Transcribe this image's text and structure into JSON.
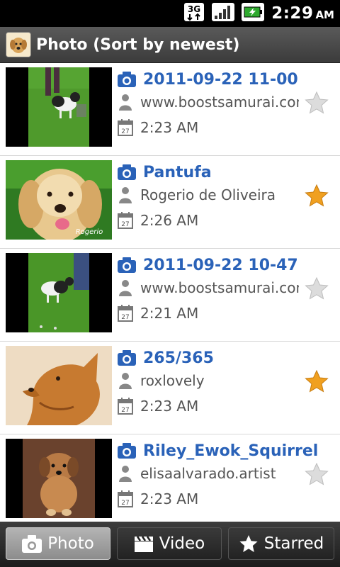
{
  "status_bar": {
    "network": "3G",
    "time": "2:29",
    "ampm": "AM"
  },
  "header": {
    "title": "Photo (Sort by newest)"
  },
  "photos": [
    {
      "title": "2011-09-22 11-00",
      "author": "www.boostsamurai.com",
      "time": "2:23 AM",
      "starred": false,
      "thumb": "dog-on-grass-1"
    },
    {
      "title": "Pantufa",
      "author": "Rogerio de Oliveira",
      "time": "2:26 AM",
      "starred": true,
      "thumb": "golden-retriever",
      "watermark": "Rogerio"
    },
    {
      "title": "2011-09-22 10-47",
      "author": "www.boostsamurai.com",
      "time": "2:21 AM",
      "starred": false,
      "thumb": "dog-on-grass-2"
    },
    {
      "title": "265/365",
      "author": "roxlovely",
      "time": "2:23 AM",
      "starred": true,
      "thumb": "dog-profile"
    },
    {
      "title": "Riley_Ewok_Squirrel",
      "author": "elisaalvarado.artist",
      "time": "2:23 AM",
      "starred": false,
      "thumb": "small-dog"
    }
  ],
  "tabs": [
    {
      "label": "Photo",
      "icon": "camera-icon",
      "active": true
    },
    {
      "label": "Video",
      "icon": "clapperboard-icon",
      "active": false
    },
    {
      "label": "Starred",
      "icon": "star-icon",
      "active": false
    }
  ],
  "colors": {
    "title_blue": "#2a62b8",
    "star_gold": "#f0a020",
    "star_gray": "#d8d8d8"
  }
}
